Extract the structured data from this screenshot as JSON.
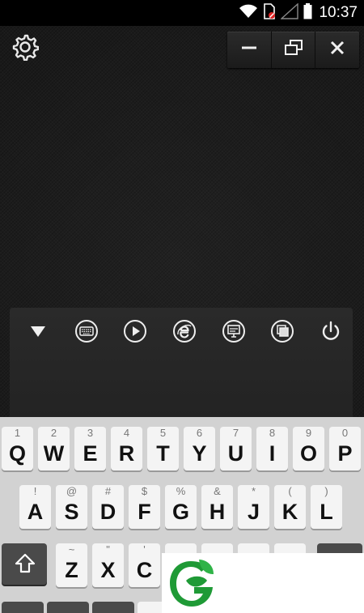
{
  "status_bar": {
    "time": "10:37",
    "icons": [
      "wifi-icon",
      "sim-card-blocked-icon",
      "signal-icon",
      "battery-icon"
    ]
  },
  "top_bar": {
    "settings_icon": "gear-icon",
    "window_controls": [
      "minimize-icon",
      "restore-icon",
      "close-icon"
    ]
  },
  "toolbar": {
    "buttons": [
      "collapse-down-icon",
      "keyboard-icon",
      "play-icon",
      "internet-explorer-icon",
      "presentation-icon",
      "window-switch-icon",
      "power-icon"
    ]
  },
  "keyboard": {
    "row1": [
      {
        "hint": "1",
        "label": "Q"
      },
      {
        "hint": "2",
        "label": "W"
      },
      {
        "hint": "3",
        "label": "E"
      },
      {
        "hint": "4",
        "label": "R"
      },
      {
        "hint": "5",
        "label": "T"
      },
      {
        "hint": "6",
        "label": "Y"
      },
      {
        "hint": "7",
        "label": "U"
      },
      {
        "hint": "8",
        "label": "I"
      },
      {
        "hint": "9",
        "label": "O"
      },
      {
        "hint": "0",
        "label": "P"
      }
    ],
    "row2": [
      {
        "hint": "!",
        "label": "A"
      },
      {
        "hint": "@",
        "label": "S"
      },
      {
        "hint": "#",
        "label": "D"
      },
      {
        "hint": "$",
        "label": "F"
      },
      {
        "hint": "%",
        "label": "G"
      },
      {
        "hint": "&",
        "label": "H"
      },
      {
        "hint": "*",
        "label": "J"
      },
      {
        "hint": "(",
        "label": "K"
      },
      {
        "hint": ")",
        "label": "L"
      }
    ],
    "row3": [
      {
        "hint": "~",
        "label": "Z"
      },
      {
        "hint": "\"",
        "label": "X"
      },
      {
        "hint": "'",
        "label": "C"
      }
    ],
    "shift_icon": "shift-arrow-icon"
  },
  "colors": {
    "background": "#191919",
    "keyboard_bg": "#d2d2d2",
    "logo_green": "#1f9a36"
  }
}
